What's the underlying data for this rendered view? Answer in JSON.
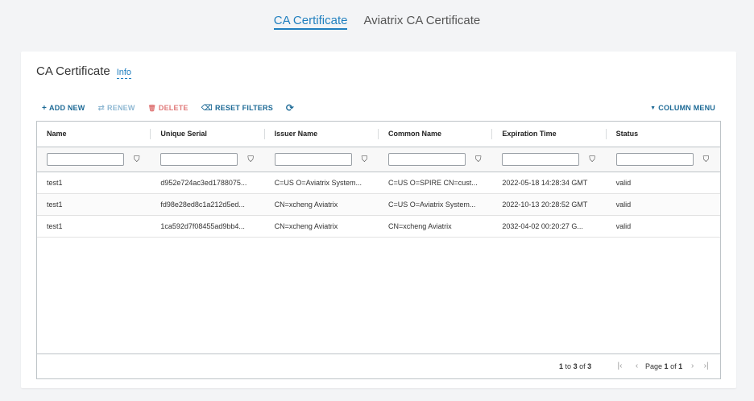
{
  "tabs": [
    {
      "label": "CA Certificate",
      "active": true
    },
    {
      "label": "Aviatrix CA Certificate",
      "active": false
    }
  ],
  "card": {
    "title": "CA Certificate",
    "info_label": "Info"
  },
  "toolbar": {
    "add": {
      "icon": "+",
      "label": "ADD NEW"
    },
    "renew": {
      "icon": "⇄",
      "label": "RENEW"
    },
    "delete": {
      "icon": "🗑",
      "label": "DELETE"
    },
    "reset": {
      "icon": "⌫",
      "label": "RESET FILTERS"
    },
    "refresh_icon": "⟳",
    "column_menu": {
      "icon": "▼",
      "label": "COLUMN MENU"
    }
  },
  "table": {
    "columns": [
      "Name",
      "Unique Serial",
      "Issuer Name",
      "Common Name",
      "Expiration Time",
      "Status"
    ],
    "filter_icon": "⛉",
    "rows": [
      [
        "test1",
        "d952e724ac3ed1788075...",
        "C=US O=Aviatrix System...",
        "C=US O=SPIRE CN=cust...",
        "2022-05-18 14:28:34 GMT",
        "valid"
      ],
      [
        "test1",
        "fd98e28ed8c1a212d5ed...",
        "CN=xcheng Aviatrix",
        "C=US O=Aviatrix System...",
        "2022-10-13 20:28:52 GMT",
        "valid"
      ],
      [
        "test1",
        "1ca592d7f08455ad9bb4...",
        "CN=xcheng Aviatrix",
        "CN=xcheng Aviatrix",
        "2032-04-02 00:20:27 G...",
        "valid"
      ]
    ]
  },
  "footer": {
    "from": "1",
    "to_word": "to",
    "to": "3",
    "of_word": "of",
    "total": "3",
    "page_word": "Page",
    "page": "1",
    "pages": "1",
    "first_icon": "|‹",
    "prev_icon": "‹",
    "next_icon": "›",
    "last_icon": "›|"
  }
}
